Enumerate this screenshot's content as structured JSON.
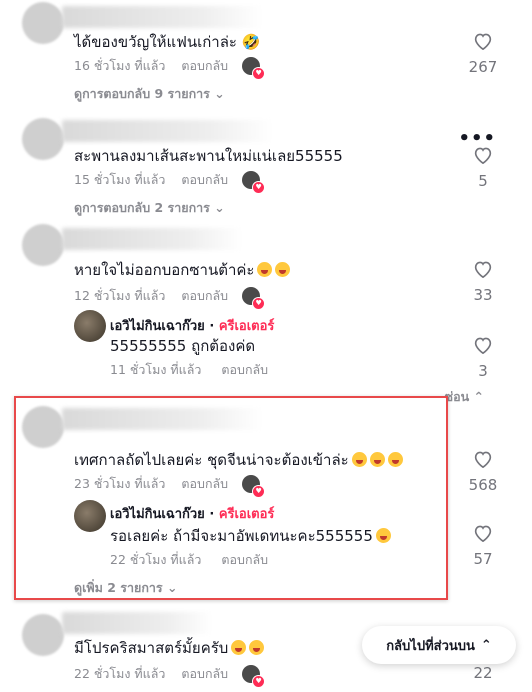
{
  "comments": [
    {
      "text": "ได้ของขวัญให้แฟนเก่าล่ะ 🤣",
      "time": "16 ชั่วโมง ที่แล้ว",
      "reply": "ตอบกลับ",
      "likes": "267",
      "view_replies": "ดูการตอบกลับ 9 รายการ"
    },
    {
      "text": "สะพานลงมาเส้นสะพานใหม่แน่เลย55555",
      "time": "15 ชั่วโมง ที่แล้ว",
      "reply": "ตอบกลับ",
      "likes": "5",
      "view_replies": "ดูการตอบกลับ 2 รายการ"
    },
    {
      "text": "หายใจไม่ออกบอกซานต้าค่ะ",
      "time": "12 ชั่วโมง ที่แล้ว",
      "reply": "ตอบกลับ",
      "likes": "33",
      "creator_reply": {
        "author": "เอวิไม่กินเฉาก๊วย",
        "badge": "ครีเอเตอร์",
        "text": "55555555 ถูกต้องค่ด",
        "time": "11 ชั่วโมง ที่แล้ว",
        "reply": "ตอบกลับ",
        "likes": "3"
      },
      "hide": "ซ่อน"
    },
    {
      "text": "เทศกาลถัดไปเลยค่ะ ชุดจีนน่าจะต้องเข้าล่ะ",
      "time": "23 ชั่วโมง ที่แล้ว",
      "reply": "ตอบกลับ",
      "likes": "568",
      "creator_reply": {
        "author": "เอวิไม่กินเฉาก๊วย",
        "badge": "ครีเอเตอร์",
        "text": "รอเลยค่ะ ถ้ามีจะมาอัพเดทนะคะ555555",
        "time": "22 ชั่วโมง ที่แล้ว",
        "reply": "ตอบกลับ",
        "likes": "57"
      },
      "view_more": "ดูเพิ่ม 2 รายการ"
    },
    {
      "text": "มีโปรคริสมาสตร์มั้ยครับ",
      "time": "22 ชั่วโมง ที่แล้ว",
      "reply": "ตอบกลับ",
      "likes": "22"
    }
  ],
  "back_to_top": "กลับไปที่ส่วนบน",
  "colors": {
    "creator": "#fe2c55",
    "highlight": "#e8494a",
    "meta": "#8a8b91"
  }
}
